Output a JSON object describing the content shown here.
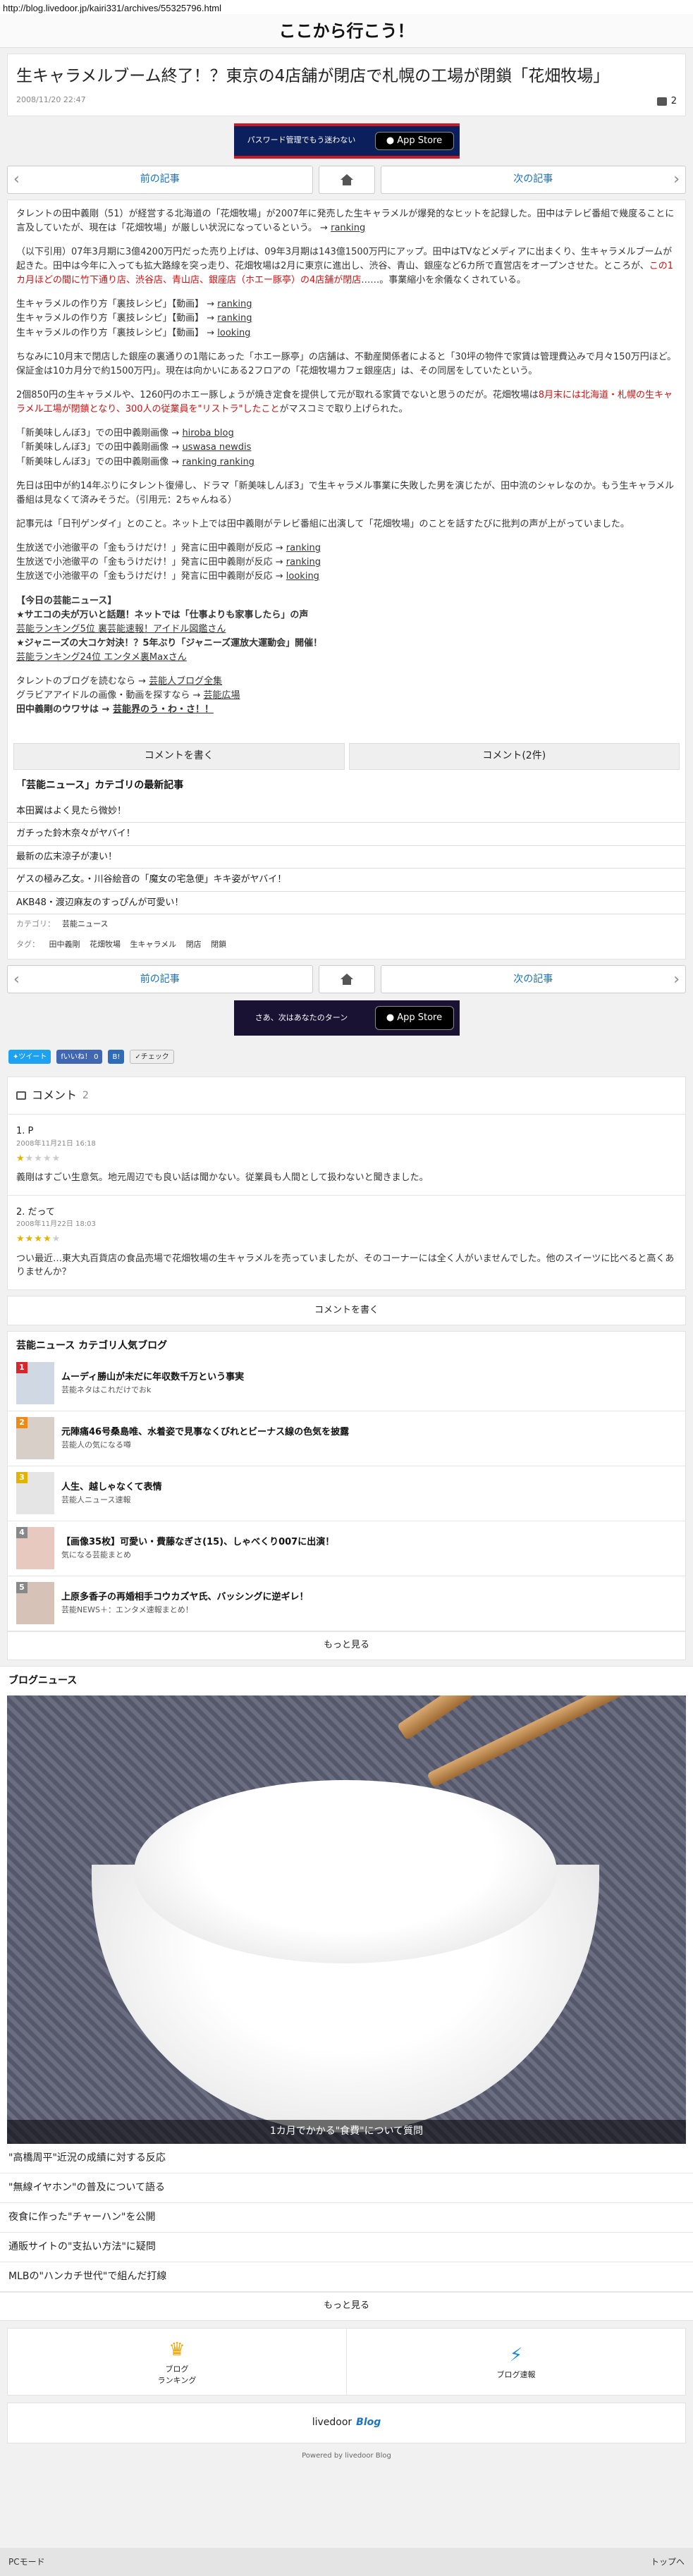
{
  "url": "http://blog.livedoor.jp/kairi331/archives/55325796.html",
  "site": {
    "title": "ここから行こう！"
  },
  "article": {
    "title": "生キャラメルブーム終了！？東京の4店舗が閉店で札幌の工場が閉鎖「花畑牧場」",
    "date": "2008/11/20 22:47",
    "comment_count": "2"
  },
  "banner1": {
    "text": "パスワード管理でもう迷わない",
    "store": "App Store"
  },
  "nav": {
    "prev": "前の記事",
    "next": "次の記事"
  },
  "body": {
    "p1": "タレントの田中義剛（51）が経営する北海道の「花畑牧場」が2007年に発売した生キャラメルが爆発的なヒットを記録した。田中はテレビ番組で幾度ることに言及していたが、現在は「花畑牧場」が厳しい状況になっているという。",
    "p1_link": "ranking",
    "p2": "（以下引用）07年3月期に3億4200万円だった売り上げは、09年3月期は143億1500万円にアップ。田中はTVなどメディアに出まくり、生キャラメルブームが起きた。田中は今年に入っても拡大路線を突っ走り、花畑牧場は2月に東京に進出し、渋谷、青山、銀座など6カ所で直営店をオープンさせた。ところが、",
    "p2_red": "この1カ月ほどの間に竹下通り店、渋谷店、青山店、銀座店（ホエー豚亭）の4店舗が閉店",
    "p2_tail": "……。事業縮小を余儀なくされている。",
    "recipes": [
      {
        "text": "生キャラメルの作り方「裏技レシピ」【動画】 → ",
        "link": "ranking"
      },
      {
        "text": "生キャラメルの作り方「裏技レシピ」【動画】 → ",
        "link": "ranking"
      },
      {
        "text": "生キャラメルの作り方「裏技レシピ」【動画】 → ",
        "link": "looking"
      }
    ],
    "p3": "ちなみに10月末で閉店した銀座の裏通りの1階にあった「ホエー豚亭」の店舗は、不動産関係者によると「30坪の物件で家賃は管理費込みで月々150万円ほど。保証金は10カ月分で約1500万円」。現在は向かいにある2フロアの「花畑牧場カフェ銀座店」は、その同居をしていたという。",
    "p4": "2個850円の生キャラメルや、1260円のホエー豚しょうが焼き定食を提供して元が取れる家賃でないと思うのだが。花畑牧場は",
    "p4_red": "8月末には北海道・札幌の生キャラメル工場が閉鎖となり、300人の従業員を\"リストラ\"したこと",
    "p4_tail": "がマスコミで取り上げられた。",
    "mangas": [
      {
        "text": "「新美味しんぼ3」での田中義剛画像 → ",
        "link": "hiroba blog"
      },
      {
        "text": "「新美味しんぼ3」での田中義剛画像 → ",
        "link": "uswasa newdis"
      },
      {
        "text": "「新美味しんぼ3」での田中義剛画像 → ",
        "link": "ranking ranking"
      }
    ],
    "p5": "先日は田中が約14年ぶりにタレント復帰し、ドラマ「新美味しんぼ3」で生キャラメル事業に失敗した男を演じたが、田中流のシャレなのか。もう生キャラメル番組は見なくて済みそうだ。（引用元：2ちゃんねる）",
    "p6": "記事元は「日刊ゲンダイ」とのこと。ネット上では田中義剛がテレビ番組に出演して「花畑牧場」のことを話すたびに批判の声が上がっていました。",
    "news": [
      {
        "text": "生放送で小池徹平の「金もうけだけ！」発言に田中義剛が反応 → ",
        "link": "ranking"
      },
      {
        "text": "生放送で小池徹平の「金もうけだけ！」発言に田中義剛が反応 → ",
        "link": "ranking"
      },
      {
        "text": "生放送で小池徹平の「金もうけだけ！」発言に田中義剛が反応 → ",
        "link": "looking"
      }
    ],
    "today_title": "【今日の芸能ニュース】",
    "today": [
      "★サエコの夫が万いと話題！ネットでは「仕事よりも家事したら」の声",
      "芸能ランキング5位 裏芸能速報！アイドル図鑑さん",
      "★ジャニーズの大コケ対決！？5年ぶり「ジャニーズ運放大運動会」開催！",
      "芸能ランキング24位 エンタメ裏Maxさん"
    ],
    "blog_lines": [
      {
        "text": "タレントのブログを読むなら → ",
        "link": "芸能人ブログ全集"
      },
      {
        "text": "グラビアアイドルの画像・動画を探すなら → ",
        "link": "芸能広場"
      },
      {
        "text": "田中義剛のウワサは → ",
        "link": "芸能界のう・わ・さ！！"
      }
    ]
  },
  "actions": {
    "write": "コメントを書く",
    "comments": "コメント(2件)"
  },
  "category_latest": {
    "title": "「芸能ニュース」カテゴリの最新記事",
    "items": [
      "本田翼はよく見たら微妙！",
      "ガチった鈴木奈々がヤバイ！",
      "最新の広末涼子が凄い！",
      "ゲスの極み乙女。・川谷絵音の「魔女の宅急便」キキ姿がヤバイ！",
      "AKB48・渡辺麻友のすっぴんが可愛い！"
    ]
  },
  "meta": {
    "category_label": "カテゴリ：",
    "category": "芸能ニュース",
    "tag_label": "タグ：",
    "tags": [
      "田中義剛",
      "花畑牧場",
      "生キャラメル",
      "閉店",
      "閉鎖"
    ]
  },
  "banner2": {
    "text": "さあ、次はあなたのターン",
    "store": "App Store"
  },
  "social": {
    "tweet": "ツイート",
    "like": "いいね！ 0",
    "check": "チェック"
  },
  "comments": {
    "title": "コメント",
    "count": "2",
    "items": [
      {
        "who": "1. P",
        "date": "2008年11月21日 16:18",
        "stars_on": 1,
        "stars_off": 4,
        "text": "義剛はすごい生意気。地元周辺でも良い話は聞かない。従業員も人間として扱わないと聞きました。"
      },
      {
        "who": "2. だって",
        "date": "2008年11月22日 18:03",
        "stars_on": 4,
        "stars_off": 1,
        "text": "つい最近…東大丸百貨店の食品売場で花畑牧場の生キャラメルを売っていましたが、そのコーナーには全く人がいませんでした。他のスイーツに比べると高くありませんか？"
      }
    ],
    "write": "コメントを書く"
  },
  "ranking": {
    "title": "芸能ニュース カテゴリ人気ブログ",
    "items": [
      {
        "rank": "1",
        "title": "ムーディ勝山が未だに年収数千万という事実",
        "sub": "芸能ネタはこれだけでおk",
        "color": "#d9262b"
      },
      {
        "rank": "2",
        "title": "元陣痛46号桑島唯、水着姿で見事なくびれとビーナス線の色気を披露",
        "sub": "芸能人の気になる噂",
        "color": "#f08a17"
      },
      {
        "rank": "3",
        "title": "人生、越しゃなくて表情",
        "sub": "芸能人ニュース速報",
        "color": "#e2b400"
      },
      {
        "rank": "4",
        "title": "【画像35枚】可愛い・費藤なぎさ(15)、しゃべくり007に出演！",
        "sub": "気になる芸能まとめ",
        "color": "#888888"
      },
      {
        "rank": "5",
        "title": "上原多香子の再婚相手コウカズヤ氏、バッシングに逆ギレ！",
        "sub": "芸能NEWS＋：エンタメ速報まとめ！",
        "color": "#888888"
      }
    ],
    "more": "もっと見る"
  },
  "blog_news": {
    "title": "ブログニュース",
    "caption": "1カ月でかかる\"食費\"について質問",
    "items": [
      "\"高橋周平\"近況の成績に対する反応",
      "\"無線イヤホン\"の普及について語る",
      "夜食に作った\"チャーハン\"を公開",
      "通販サイトの\"支払い方法\"に疑問",
      "MLBの\"ハンカチ世代\"で組んだ打線"
    ],
    "more": "もっと見る"
  },
  "footer": {
    "ranking": "ブログ\nランキング",
    "breaking": "ブログ速報",
    "brand_a": "livedoor",
    "brand_b": "Blog",
    "powered": "Powered by livedoor Blog",
    "pc": "PCモード",
    "top": "トップへ"
  }
}
